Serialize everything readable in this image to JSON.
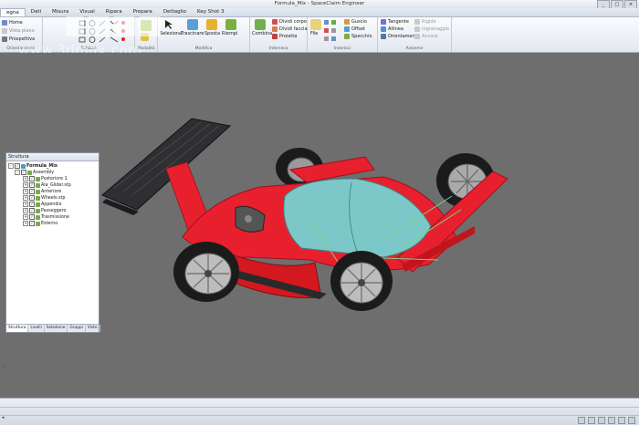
{
  "window": {
    "title": "Formula_Mix - SpaceClaim Engineer",
    "buttons": [
      "_",
      "□",
      "×"
    ]
  },
  "tabs": [
    "egna",
    "Dati",
    "Misura",
    "Visual",
    "Ripara",
    "Prepara",
    "Dettaglio",
    "Key Shot 3"
  ],
  "active_tab": "egna",
  "ribbon": {
    "orient": {
      "label": "Orientamento",
      "items": [
        "Home",
        "Vista piano",
        "Prospettiva"
      ]
    },
    "sketch": {
      "label": "Schizzo"
    },
    "mode": {
      "label": "Modalità"
    },
    "edit": {
      "label": "Modifica",
      "items": [
        "Seleziona",
        "Trascinare",
        "Sposta",
        "Riempi"
      ]
    },
    "intersect": {
      "label": "Interseca",
      "items": [
        "Combina",
        "Dividi corpo",
        "Dividi faccia",
        "Proietta"
      ]
    },
    "insert": {
      "label": "Inserisci",
      "items": [
        "File",
        "Guscio",
        "Offset",
        "Specchio"
      ]
    },
    "assembly": {
      "label": "Assieme",
      "items": [
        "Tangente",
        "Allinea",
        "Orientamento",
        "Rigido",
        "Ingranaggio",
        "Ancora"
      ]
    }
  },
  "watermark": {
    "text": "www.3dmax.com"
  },
  "structure": {
    "header": "Struttura",
    "root": "Formula_Mix",
    "assembly": "Assembly",
    "children": [
      "Posteriore 1",
      "Ala_Glider.stp",
      "Anteriore",
      "Wheels.stp",
      "Appendix",
      "Passeggero",
      "Trasmissione",
      "Esterno"
    ],
    "tabs": [
      "Struttura",
      "Livelli",
      "Selezione",
      "Gruppi",
      "Viste"
    ]
  },
  "colors": {
    "car_body": "#e8202e",
    "canopy": "#7cc8c8",
    "viewport": "#6e6e6e",
    "wing": "#2f2f33"
  }
}
